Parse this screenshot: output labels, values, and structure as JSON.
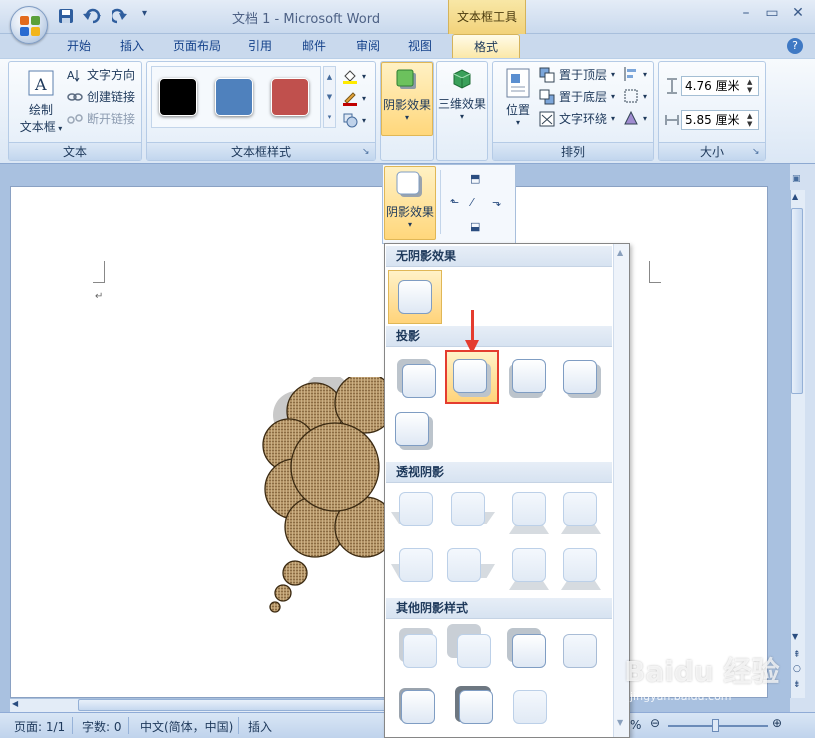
{
  "window": {
    "doc_title": "文档 1 - Microsoft Word",
    "tool_tab_caption": "文本框工具"
  },
  "tabs": [
    "开始",
    "插入",
    "页面布局",
    "引用",
    "邮件",
    "审阅",
    "视图",
    "格式"
  ],
  "active_tab": "格式",
  "ribbon": {
    "text_group": {
      "label": "文本",
      "draw_textbox_line1": "绘制",
      "draw_textbox_line2": "文本框",
      "text_direction": "文字方向",
      "create_link": "创建链接",
      "break_link": "断开链接"
    },
    "style_group": {
      "label": "文本框样式",
      "swatches": [
        "#000000",
        "#4f81bd",
        "#c0504d"
      ]
    },
    "shadow_effect": "阴影效果",
    "three_d_effect": "三维效果",
    "arrange_group": {
      "label": "排列",
      "position": "位置",
      "bring_to_front": "置于顶层",
      "send_to_back": "置于底层",
      "text_wrap": "文字环绕"
    },
    "size_group": {
      "label": "大小",
      "height": "4.76 厘米",
      "width": "5.85 厘米"
    }
  },
  "shadow_split_label": "阴影效果",
  "gallery": {
    "no_shadow": "无阴影效果",
    "drop_shadow": "投影",
    "perspective_shadow": "透视阴影",
    "other_shadow": "其他阴影样式"
  },
  "statusbar": {
    "page": "页面: 1/1",
    "words": "字数: 0",
    "language": "中文(简体，中国)",
    "mode": "插入",
    "zoom_partial": "%"
  },
  "watermark": {
    "main": "Baidu 经验",
    "sub": "jingyan.baidu.com"
  },
  "colors": {
    "accent": "#e43c2f",
    "ribbon_bg": "#dbe7f5"
  }
}
